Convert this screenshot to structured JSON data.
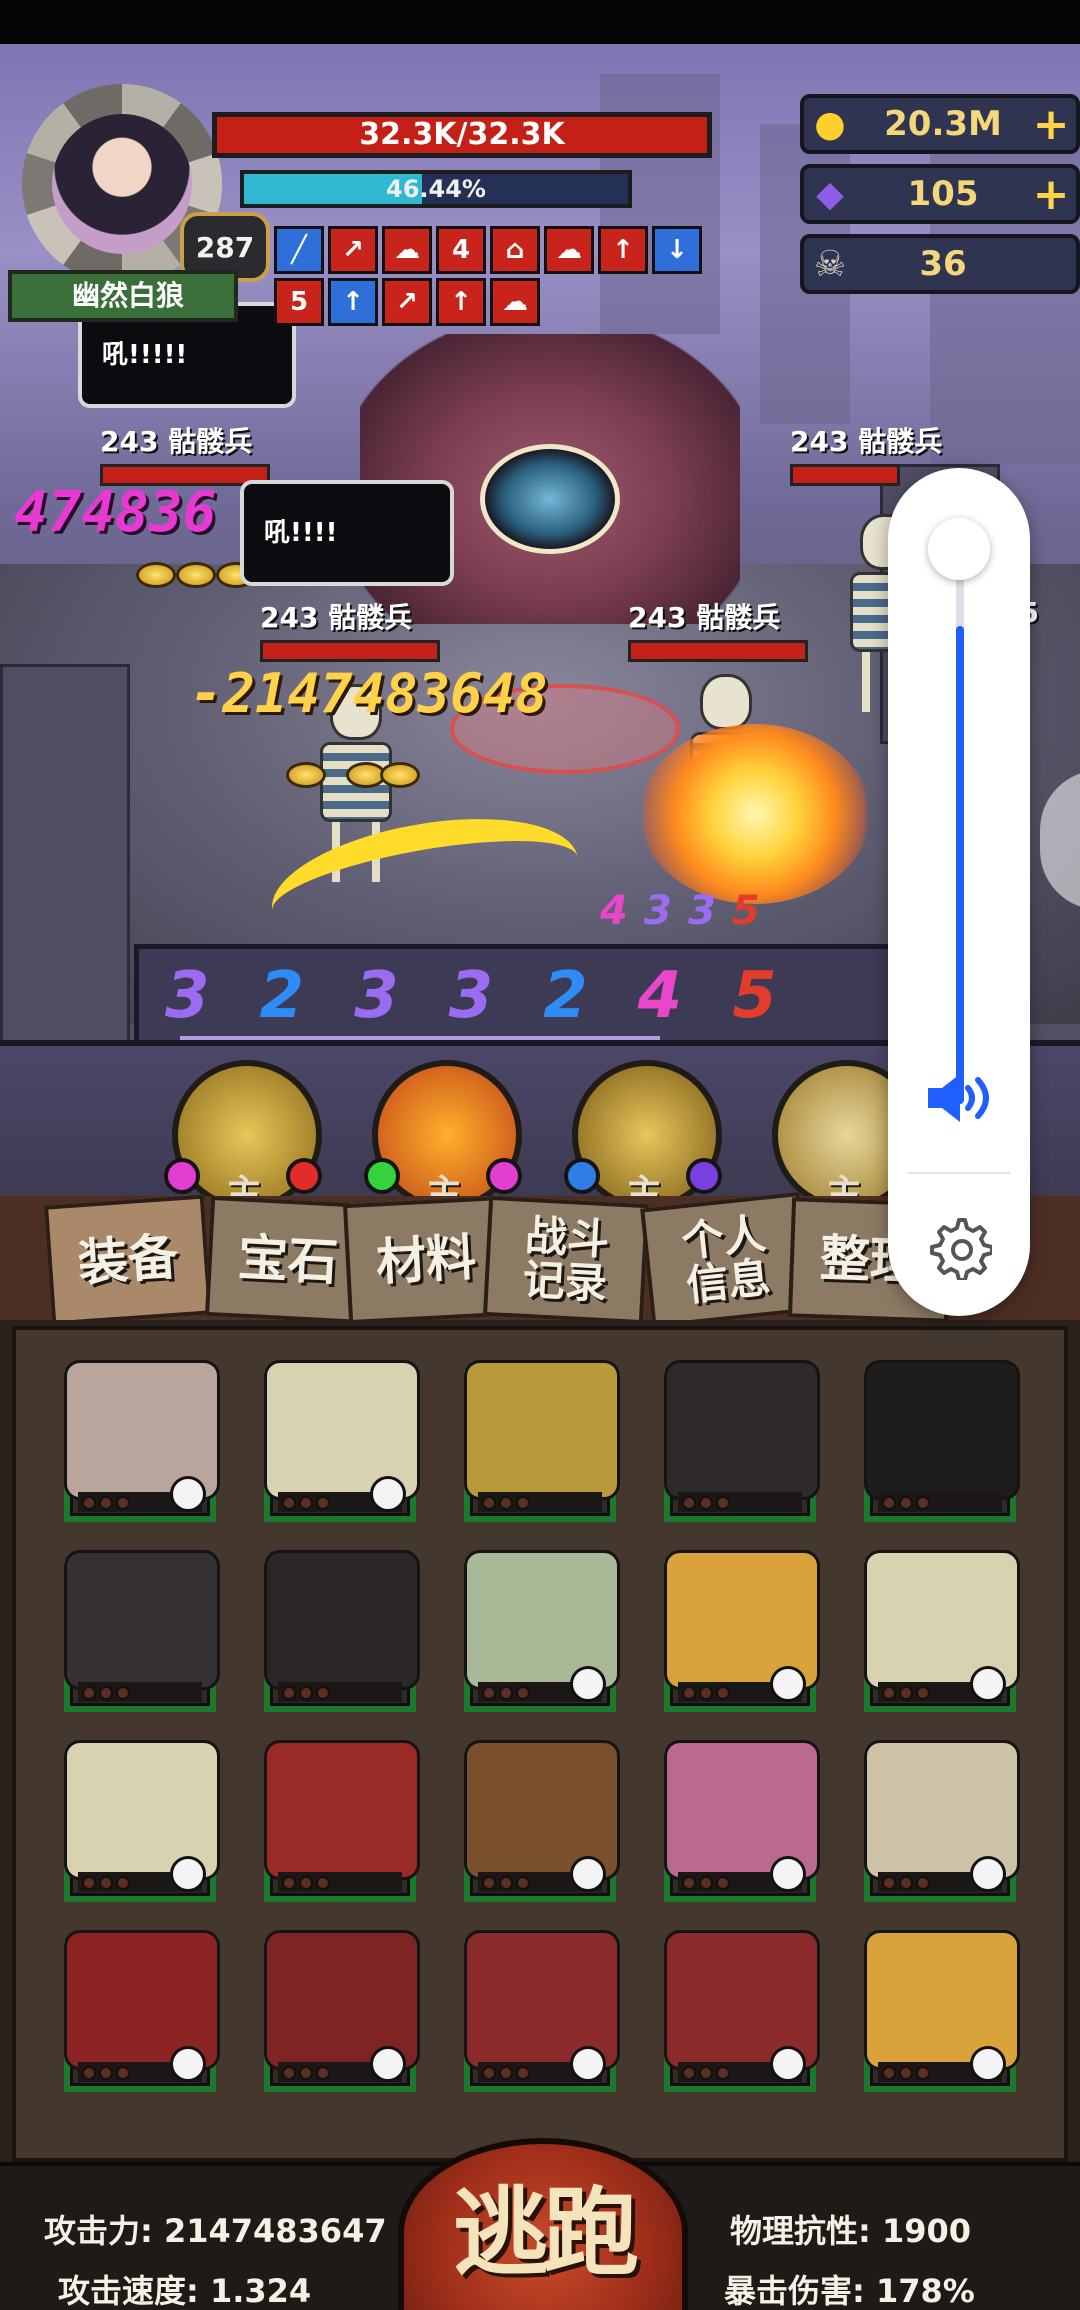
{
  "hero": {
    "level": "287",
    "name": "幽然白狼",
    "hp_text": "32.3K/32.3K",
    "xp_text": "46.44%",
    "xp_fraction": 0.4644
  },
  "currencies": [
    {
      "icon": "gold-coin-icon",
      "value": "20.3M",
      "has_plus": true
    },
    {
      "icon": "purple-gem-icon",
      "value": "105",
      "has_plus": true
    },
    {
      "icon": "ram-skull-icon",
      "value": "36",
      "has_plus": false
    }
  ],
  "buffs_row1": [
    {
      "glyph": "╱",
      "color": "#2e6fd9"
    },
    {
      "glyph": "↗",
      "color": "#c8241b"
    },
    {
      "glyph": "☁",
      "color": "#c8241b"
    },
    {
      "glyph": "4",
      "color": "#c8241b"
    },
    {
      "glyph": "⌂",
      "color": "#c8241b"
    },
    {
      "glyph": "☁",
      "color": "#c8241b"
    },
    {
      "glyph": "↑",
      "color": "#c8241b"
    },
    {
      "glyph": "↓",
      "color": "#2e6fd9"
    }
  ],
  "buffs_row2": [
    {
      "glyph": "5",
      "color": "#c8241b"
    },
    {
      "glyph": "↑",
      "color": "#2e6fd9"
    },
    {
      "glyph": "↗",
      "color": "#c8241b"
    },
    {
      "glyph": "↑",
      "color": "#c8241b"
    },
    {
      "glyph": "☁",
      "color": "#c8241b"
    }
  ],
  "battle": {
    "bubble_1": "吼!!!!!",
    "bubble_2": "吼!!!!",
    "enemies": [
      {
        "label": "243 骷髅兵"
      },
      {
        "label": "243 骷髅兵"
      },
      {
        "label": "243 骷髅兵"
      },
      {
        "label": "243 骷髅兵"
      }
    ],
    "enemy_badge": "25",
    "damage_magenta": "474836 48",
    "damage_main": "-2147483648"
  },
  "combo": {
    "numbers": [
      "3",
      "2",
      "3",
      "3",
      "2",
      "4",
      "5"
    ],
    "colors": [
      "#9b6cf0",
      "#2f8cf4",
      "#9b6cf0",
      "#9b6cf0",
      "#2f8cf4",
      "#e847c9",
      "#e23d2a"
    ],
    "mini": [
      "4",
      "3",
      "3",
      "5"
    ],
    "mini_colors": [
      "#e847c9",
      "#9b6cf0",
      "#9b6cf0",
      "#e23d2a"
    ]
  },
  "skills": {
    "tag": "主",
    "sockets": [
      "#e23fd0",
      "#e22a2a",
      "#34d23c",
      "#e23fd0",
      "#2f7ee8",
      "#7a3fe0"
    ]
  },
  "tabs": [
    {
      "label": "装备"
    },
    {
      "label": "宝石"
    },
    {
      "label": "材料"
    },
    {
      "label": "战斗\n记录"
    },
    {
      "label": "个人\n信息"
    },
    {
      "label": "整理"
    }
  ],
  "inventory": {
    "items": [
      {
        "name": "fang-ring",
        "color": "#b9a59c",
        "tag": "skull"
      },
      {
        "name": "rib-armor",
        "color": "#d9d2b0",
        "tag": "spirit"
      },
      {
        "name": "gold-helm",
        "color": "#b99a3a",
        "tag": ""
      },
      {
        "name": "dark-boots",
        "color": "#2f2a2a",
        "tag": ""
      },
      {
        "name": "dark-robe",
        "color": "#1f1c1c",
        "tag": ""
      },
      {
        "name": "spiked-armor",
        "color": "#353034",
        "tag": ""
      },
      {
        "name": "gold-crowned-robe",
        "color": "#2b2628",
        "tag": ""
      },
      {
        "name": "green-shell",
        "color": "#a9b896",
        "tag": "spirit"
      },
      {
        "name": "gold-star-amulet",
        "color": "#d9a23a",
        "tag": "spirit"
      },
      {
        "name": "rib-armor-2",
        "color": "#d9d2b0",
        "tag": "spirit"
      },
      {
        "name": "rib-armor-3",
        "color": "#d9d2b0",
        "tag": "spirit"
      },
      {
        "name": "red-knight-helm",
        "color": "#9a2a26",
        "tag": ""
      },
      {
        "name": "hide-skirt",
        "color": "#7a4f2c",
        "tag": "skull"
      },
      {
        "name": "crystal-claw",
        "color": "#b96a8e",
        "tag": "skull"
      },
      {
        "name": "bone-gauntlet",
        "color": "#cfc3a7",
        "tag": "skull"
      },
      {
        "name": "red-horn-helm",
        "color": "#8c2424",
        "tag": "demon"
      },
      {
        "name": "red-horn-crown",
        "color": "#7e2424",
        "tag": "demon"
      },
      {
        "name": "red-horn-cloak",
        "color": "#8a2a2a",
        "tag": "demon"
      },
      {
        "name": "red-bone-gauntlet",
        "color": "#8a2a2a",
        "tag": "demon"
      },
      {
        "name": "gold-sash",
        "color": "#d9a23a",
        "tag": "demon"
      }
    ]
  },
  "stats": {
    "attack": "攻击力: 2147483647",
    "attack_speed": "攻击速度: 1.324",
    "phys_res": "物理抗性: 1900",
    "crit_dmg": "暴击伤害: 178%",
    "flee_label": "逃跑"
  },
  "volume": {
    "level_fraction": 0.86
  },
  "colors": {
    "slot_border": "#1c7a2e",
    "hp_red": "#c42018",
    "xp_cyan": "#2fb8d2",
    "volume_blue": "#1f5fff"
  }
}
